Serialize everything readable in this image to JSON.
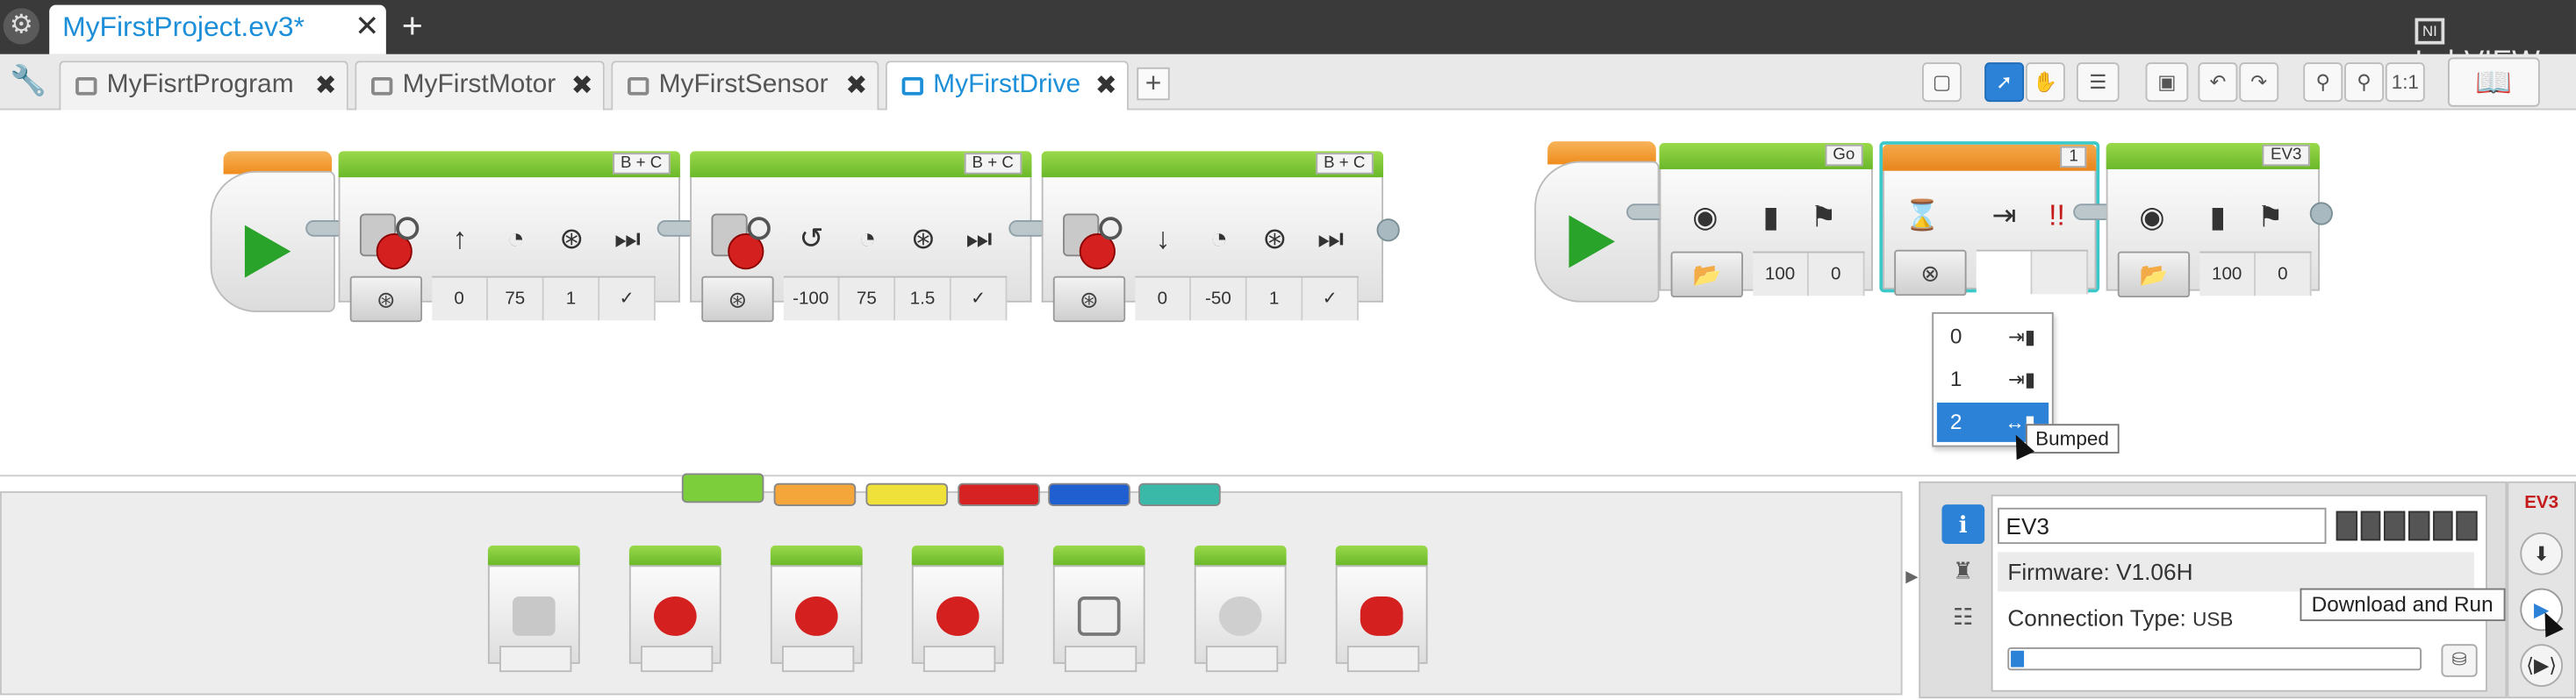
{
  "app": {
    "brand": "LabVIEW",
    "brand_prefix": "NATIONAL INSTRUMENTS"
  },
  "project_tab": {
    "label": "MyFirstProject.ev3*"
  },
  "program_tabs": [
    {
      "label": "MyFisrtProgram"
    },
    {
      "label": "MyFirstMotor"
    },
    {
      "label": "MyFirstSensor"
    },
    {
      "label": "MyFirstDrive",
      "active": true
    }
  ],
  "toolbar": {
    "zoom_reset": "1:1"
  },
  "program1": {
    "blocks": [
      {
        "port": "B + C",
        "values": [
          "0",
          "75",
          "1",
          "✓"
        ]
      },
      {
        "port": "B + C",
        "values": [
          "-100",
          "75",
          "1.5",
          "✓"
        ]
      },
      {
        "port": "B + C",
        "values": [
          "0",
          "-50",
          "1",
          "✓"
        ]
      }
    ]
  },
  "program2": {
    "sound1": {
      "label": "Go",
      "values": [
        "100",
        "0"
      ]
    },
    "timer": {
      "label": "1"
    },
    "sound2": {
      "label": "EV3",
      "values": [
        "100",
        "0"
      ]
    }
  },
  "dropdown": {
    "items": [
      {
        "value": "0"
      },
      {
        "value": "1"
      },
      {
        "value": "2",
        "selected": true
      }
    ],
    "tooltip": "Bumped"
  },
  "palette": {
    "tab_colors": [
      "#7ccf3a",
      "#f5a63a",
      "#f0e03a",
      "#d62222",
      "#1f5fd0",
      "#3ab8a8"
    ]
  },
  "hardware": {
    "brick_name": "EV3",
    "firmware": "Firmware: V1.06H",
    "connection_label": "Connection Type:",
    "connection_value": "USB",
    "memory_fraction": 0.03
  },
  "download": {
    "badge": "EV3",
    "tooltip": "Download and Run"
  }
}
